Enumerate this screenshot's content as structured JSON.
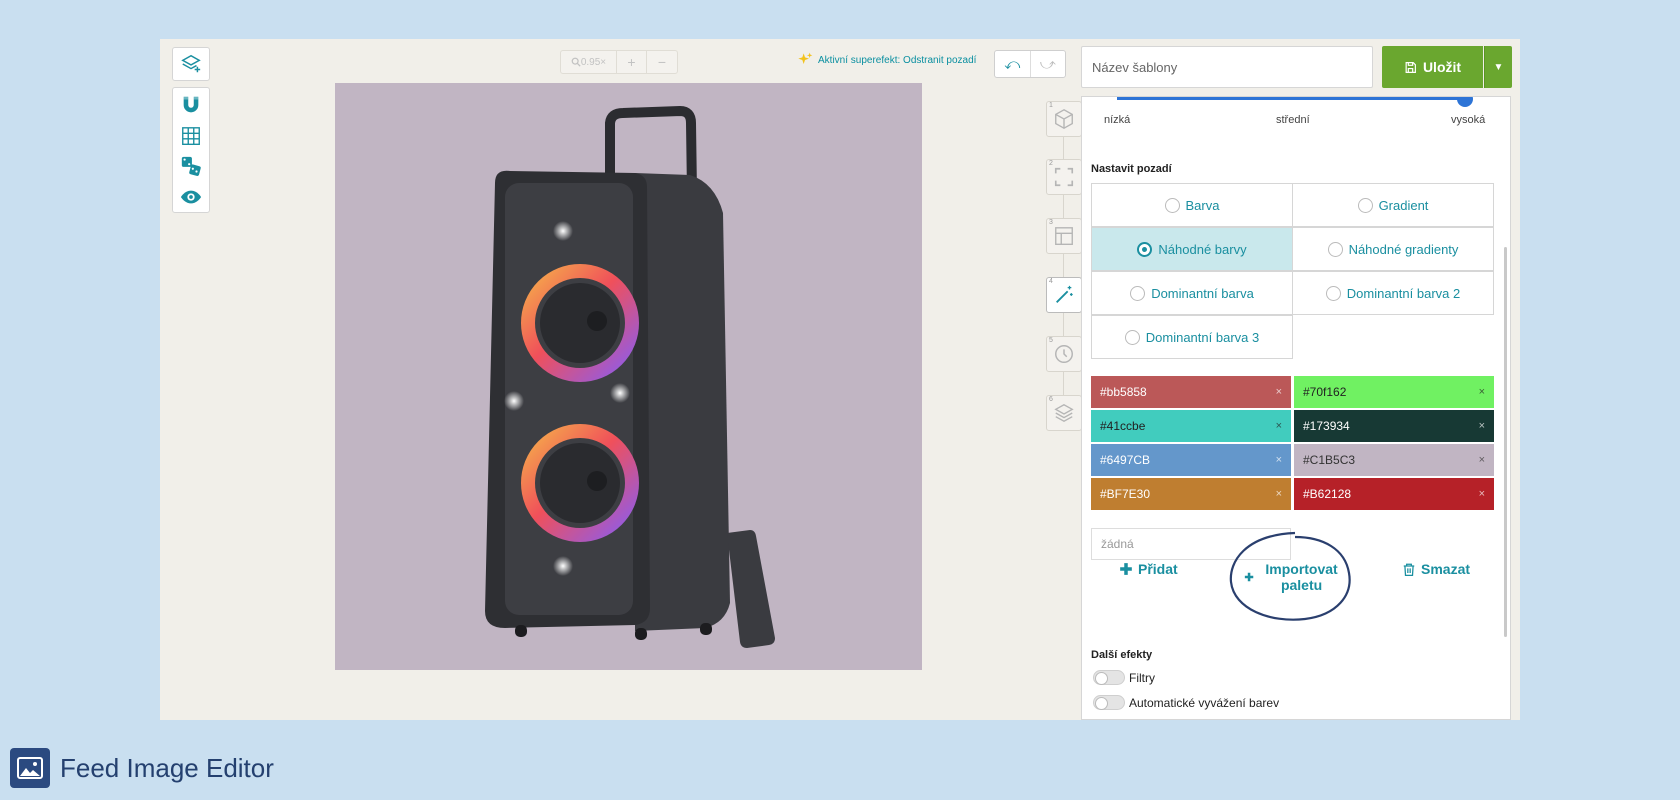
{
  "zoom": {
    "value": "0.95×",
    "plus": "+",
    "minus": "−"
  },
  "superfx": {
    "label": "Aktivní superefekt: Odstranit pozadí"
  },
  "header": {
    "template_placeholder": "Název šablony",
    "save_label": "Uložit"
  },
  "steps": [
    "1",
    "2",
    "3",
    "4",
    "5",
    "6"
  ],
  "slider": {
    "labels": [
      "nízká",
      "střední",
      "vysoká"
    ],
    "value": "vysoká"
  },
  "background": {
    "title": "Nastavit pozadí",
    "options": [
      "Barva",
      "Gradient",
      "Náhodné barvy",
      "Náhodné gradienty",
      "Dominantní barva",
      "Dominantní barva 2",
      "Dominantní barva 3"
    ],
    "selected": "Náhodné barvy"
  },
  "palette": {
    "colors": [
      {
        "hex": "#bb5858",
        "label": "#bb5858"
      },
      {
        "hex": "#70f162",
        "label": "#70f162"
      },
      {
        "hex": "#41ccbe",
        "label": "#41ccbe"
      },
      {
        "hex": "#173934",
        "label": "#173934"
      },
      {
        "hex": "#6497CB",
        "label": "#6497CB"
      },
      {
        "hex": "#C1B5C3",
        "label": "#C1B5C3"
      },
      {
        "hex": "#BF7E30",
        "label": "#BF7E30"
      },
      {
        "hex": "#B62128",
        "label": "#B62128"
      }
    ],
    "remove": "×",
    "none_placeholder": "žádná",
    "add": "Přidat",
    "import": "Importovat paletu",
    "delete": "Smazat"
  },
  "effects": {
    "title": "Další efekty",
    "items": [
      "Filtry",
      "Automatické vyvážení barev"
    ]
  },
  "canvas": {
    "background": "#c1b5c3"
  },
  "brand": {
    "name": "Feed Image Editor"
  }
}
